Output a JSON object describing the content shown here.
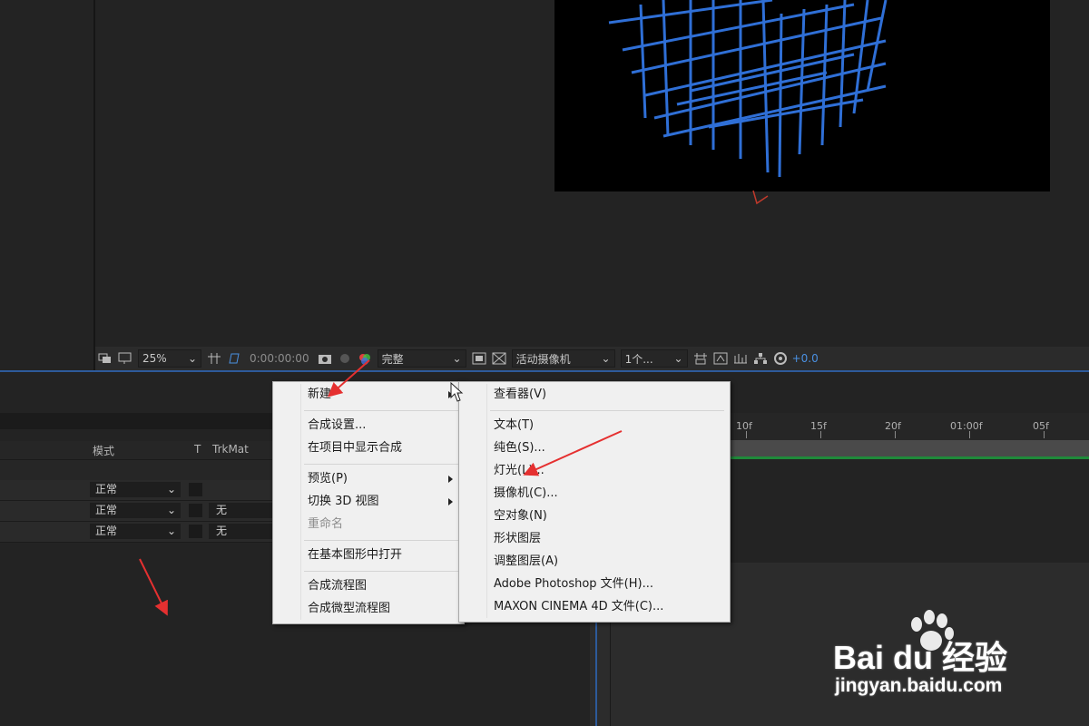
{
  "toolbar": {
    "zoom": "25%",
    "timecode": "0:00:00:00",
    "resolution": "完整",
    "camera": "活动摄像机",
    "views": "1个...",
    "exposure": "+0.0"
  },
  "timeline": {
    "headers": {
      "mode": "模式",
      "t": "T",
      "trkmat": "TrkMat"
    },
    "layers": [
      {
        "mode": "正常",
        "trkmat": ""
      },
      {
        "mode": "正常",
        "trkmat": "无"
      },
      {
        "mode": "正常",
        "trkmat": "无"
      }
    ],
    "ruler": [
      "10f",
      "15f",
      "20f",
      "01:00f",
      "05f"
    ]
  },
  "context_menu": {
    "items": [
      {
        "label": "新建"
      },
      {
        "label": "合成设置..."
      },
      {
        "label": "在项目中显示合成"
      },
      {
        "label": "预览(P)"
      },
      {
        "label": "切换 3D 视图"
      },
      {
        "label": "重命名"
      },
      {
        "label": "在基本图形中打开"
      },
      {
        "label": "合成流程图"
      },
      {
        "label": "合成微型流程图"
      }
    ]
  },
  "submenu": {
    "items": [
      {
        "label": "查看器(V)"
      },
      {
        "label": "文本(T)"
      },
      {
        "label": "纯色(S)..."
      },
      {
        "label": "灯光(L)..."
      },
      {
        "label": "摄像机(C)..."
      },
      {
        "label": "空对象(N)"
      },
      {
        "label": "形状图层"
      },
      {
        "label": "调整图层(A)"
      },
      {
        "label": "Adobe Photoshop 文件(H)..."
      },
      {
        "label": "MAXON CINEMA 4D 文件(C)..."
      }
    ]
  },
  "watermark": {
    "brand": "Bai du 经验",
    "url": "jingyan.baidu.com"
  },
  "colors": {
    "accent": "#2d5a9a",
    "menu_bg": "#f0f0f0",
    "annotation": "#e53030",
    "grid": "#2f6fd6"
  }
}
